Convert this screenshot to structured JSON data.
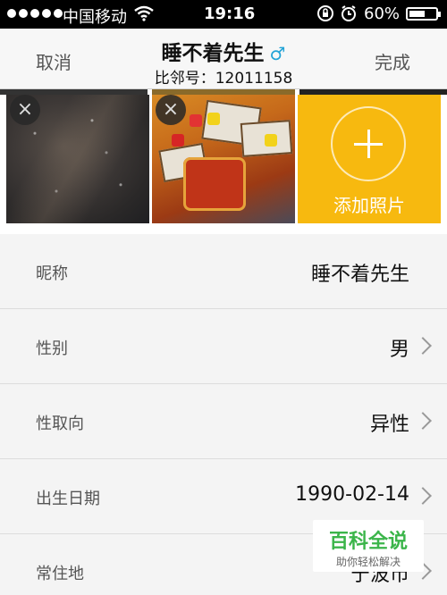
{
  "status_bar": {
    "carrier": "中国移动",
    "time": "19:16",
    "battery_percent_text": "60%",
    "battery_level": 0.6,
    "icons": [
      "signal-dots-icon",
      "wifi-icon",
      "orientation-lock-icon",
      "alarm-icon",
      "battery-icon"
    ]
  },
  "nav": {
    "cancel_label": "取消",
    "title": "睡不着先生",
    "gender_symbol": "♂",
    "subtitle": "比邻号：12011158",
    "done_label": "完成"
  },
  "photos": {
    "remove_symbol": "×",
    "items": [
      {
        "name": "photo-starry-sky"
      },
      {
        "name": "photo-board-game"
      }
    ],
    "add_label": "添加照片"
  },
  "profile_rows": [
    {
      "key": "昵称",
      "value": "睡不着先生",
      "has_chevron": false
    },
    {
      "key": "性别",
      "value": "男",
      "has_chevron": true
    },
    {
      "key": "性取向",
      "value": "异性",
      "has_chevron": true
    },
    {
      "key": "出生日期",
      "value": "1990-02-14",
      "has_chevron": true
    },
    {
      "key": "常住地",
      "value": "宁波市",
      "has_chevron": true
    }
  ],
  "watermark": {
    "title": "百科全说",
    "subtitle": "助你轻松解决"
  },
  "colors": {
    "accent_yellow": "#f7b90f",
    "gender_blue": "#22a3d6",
    "watermark_green": "#3bb54a"
  }
}
